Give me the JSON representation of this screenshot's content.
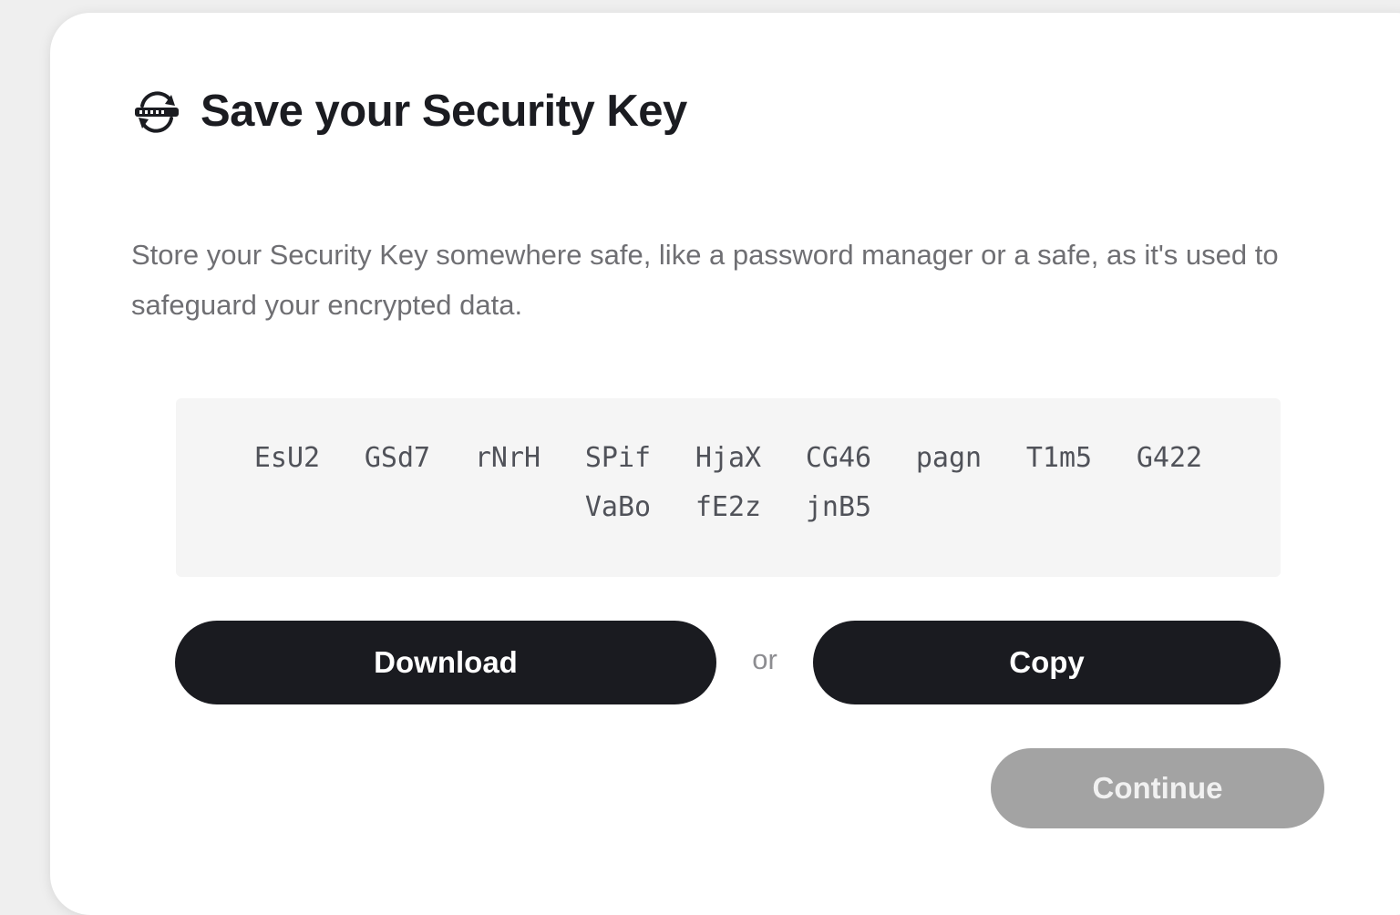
{
  "dialog": {
    "title": "Save your Security Key",
    "icon": "key-sync-icon",
    "description": "Store your Security Key somewhere safe, like a password manager or a safe, as it's used to safeguard your encrypted data.",
    "security_key": [
      "EsU2",
      "GSd7",
      "rNrH",
      "SPif",
      "HjaX",
      "CG46",
      "pagn",
      "T1m5",
      "G422",
      "VaBo",
      "fE2z",
      "jnB5"
    ],
    "download_label": "Download",
    "or_label": "or",
    "copy_label": "Copy",
    "continue_label": "Continue"
  },
  "colors": {
    "primary_button": "#1a1b20",
    "disabled_button": "#a3a3a3",
    "key_box_bg": "#f5f5f5"
  }
}
